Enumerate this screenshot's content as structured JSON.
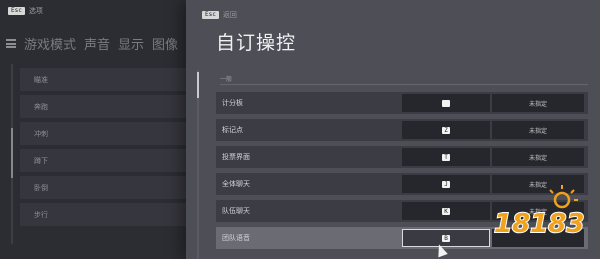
{
  "background": {
    "hint_key": "Esc",
    "hint_label": "选项",
    "tabs": [
      "游戏模式",
      "声音",
      "显示",
      "图像"
    ],
    "rows": [
      "瞄准",
      "奔跑",
      "冲刺",
      "蹲下",
      "卧倒",
      "步行"
    ]
  },
  "panel": {
    "back_key": "Esc",
    "back_label": "返回",
    "title": "自订操控",
    "section": "一般",
    "rows": [
      {
        "label": "计分板",
        "key": " ",
        "alt": "未指定"
      },
      {
        "label": "标记点",
        "key": "Z",
        "alt": "未指定"
      },
      {
        "label": "投票界面",
        "key": "T",
        "alt": "未指定"
      },
      {
        "label": "全体聊天",
        "key": "J",
        "alt": "未指定"
      },
      {
        "label": "队伍聊天",
        "key": "K",
        "alt": "未指定"
      },
      {
        "label": "团队语音",
        "key": "B",
        "alt": ""
      }
    ],
    "active_row": 5
  },
  "watermark": {
    "text": "18183",
    "colors": {
      "accent": "#f0a21c",
      "shadow": "#ffffff"
    }
  },
  "colors": {
    "panel": "#4d4e56",
    "row": "#3c3d44",
    "cell": "#26272c",
    "background": "#2c2d33"
  }
}
